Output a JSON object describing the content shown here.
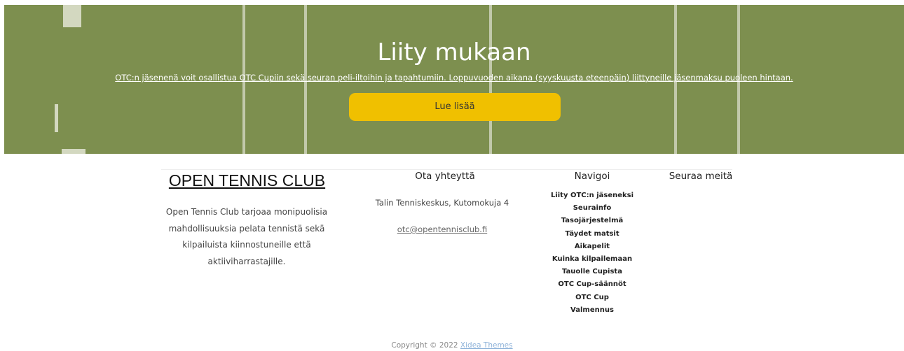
{
  "hero": {
    "title": "Liity mukaan",
    "text": "OTC:n jäsenenä voit osallistua OTC Cupiin sekä seuran peli-iltoihin ja tapahtumiin. Loppuvuoden aikana (syyskuusta eteenpäin) liittyneille jäsenmaksu puoleen hintaan.",
    "button_label": "Lue lisää"
  },
  "footer": {
    "brand_title": "OPEN TENNIS CLUB",
    "brand_description": "Open Tennis Club tarjoaa monipuolisia mahdollisuuksia pelata tennistä sekä kilpailuista kiinnostuneille että aktiiviharrastajille.",
    "contact_title": "Ota yhteyttä",
    "contact_address": "Talin Tenniskeskus, Kutomokuja 4",
    "contact_email": "otc@opentennisclub.fi",
    "nav_title": "Navigoi",
    "nav_items": [
      "Liity OTC:n jäseneksi",
      "Seurainfo",
      "Tasojärjestelmä",
      "Täydet matsit",
      "Aikapelit",
      "Kuinka kilpailemaan",
      "Tauolle Cupista",
      "OTC Cup-säännöt",
      "OTC Cup",
      "Valmennus"
    ],
    "follow_title": "Seuraa meitä"
  },
  "copyright": {
    "prefix": "Copyright © 2022 ",
    "link_label": "Xidea Themes"
  },
  "colors": {
    "hero_bg": "#7d8f4f",
    "button_bg": "#f0c000"
  }
}
